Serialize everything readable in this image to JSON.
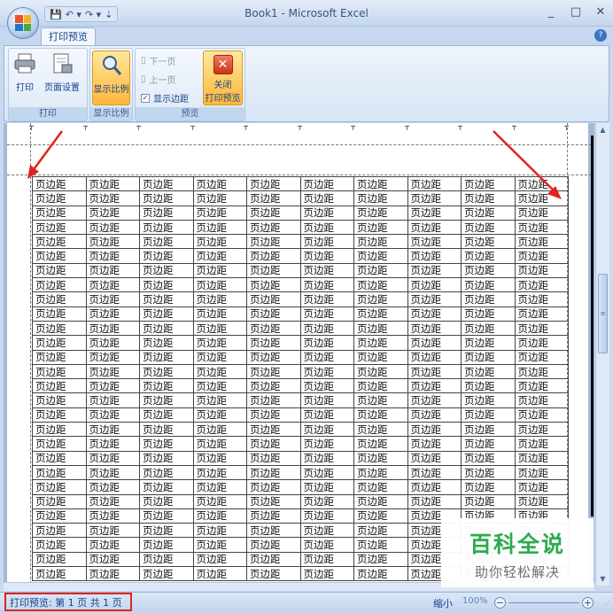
{
  "window": {
    "title": "Book1 - Microsoft Excel",
    "minimize": "_",
    "maximize": "□",
    "close": "✕"
  },
  "quick_access": {
    "save": "💾",
    "undo": "↶ ▾",
    "redo": "↷ ▾",
    "more": "⇣"
  },
  "tabs": {
    "active": "打印预览",
    "help": "?"
  },
  "ribbon": {
    "print_group": {
      "label": "打印",
      "print_button": "打印",
      "page_setup_button": "页面设置"
    },
    "zoom_group": {
      "label": "显示比例",
      "zoom_button": "显示比例"
    },
    "preview_group": {
      "label": "预览",
      "next_page": "下一页",
      "prev_page": "上一页",
      "show_margins": "显示边距",
      "show_margins_checked": "✓",
      "close_line1": "关闭",
      "close_line2": "打印预览"
    }
  },
  "sheet": {
    "cell_text": "页边距",
    "columns": 10,
    "rows": 28
  },
  "statusbar": {
    "text": "打印预览: 第 1 页  共 1 页",
    "zoom_out": "缩小",
    "zoom_value": "100%",
    "zoom_minus": "−",
    "zoom_plus": "+"
  },
  "watermark": {
    "line1": "百科全说",
    "line2": "助你轻松解决"
  },
  "colors": {
    "annotation": "#e0241a",
    "watermark_green": "#2dab4e"
  }
}
